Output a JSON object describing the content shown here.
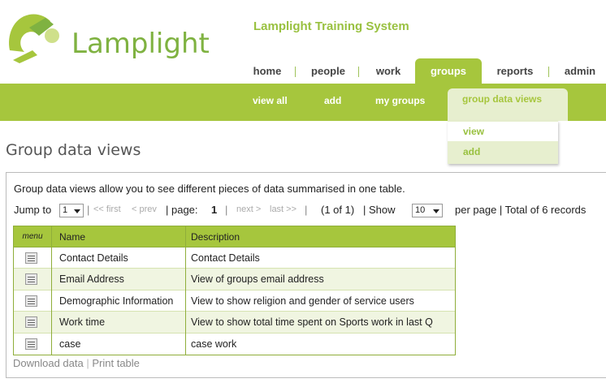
{
  "brand": {
    "logo_text": "Lamplight",
    "system_title": "Lamplight Training System"
  },
  "top_nav": {
    "items": [
      {
        "label": "home"
      },
      {
        "label": "people"
      },
      {
        "label": "work"
      },
      {
        "label": "groups",
        "active": true
      },
      {
        "label": "reports"
      },
      {
        "label": "admin"
      }
    ]
  },
  "sub_nav": {
    "items": [
      {
        "label": "view all"
      },
      {
        "label": "add"
      },
      {
        "label": "my groups"
      },
      {
        "label": "group data views",
        "active": true
      }
    ]
  },
  "dropdown": {
    "items": [
      {
        "label": "view"
      },
      {
        "label": "add"
      }
    ]
  },
  "page": {
    "heading": "Group data views",
    "intro": "Group data views allow you to see different pieces of data summarised in one table."
  },
  "pager": {
    "jump_to_label": "Jump to",
    "jump_value": "1",
    "first": "<< first",
    "prev": "< prev",
    "page_label": "| page:",
    "page_value": "1",
    "next": "next >",
    "last": "last >>",
    "of_text": "(1 of 1)",
    "show_label": "| Show",
    "show_value": "10",
    "summary": "per page | Total of 6  records"
  },
  "table": {
    "headers": {
      "menu": "menu",
      "name": "Name",
      "description": "Description"
    },
    "rows": [
      {
        "name": "Contact Details",
        "description": "Contact Details"
      },
      {
        "name": "Email Address",
        "description": "View of groups email address"
      },
      {
        "name": "Demographic Information",
        "description": "View to show religion and gender of service users"
      },
      {
        "name": "Work time",
        "description": "View to show total time spent on Sports work in last Q"
      },
      {
        "name": "case",
        "description": "case work"
      }
    ]
  },
  "footer": {
    "download": "Download data",
    "print": "Print table"
  },
  "colors": {
    "accent": "#a6c63d",
    "logo": "#7fb241",
    "light": "#e7efcf"
  }
}
